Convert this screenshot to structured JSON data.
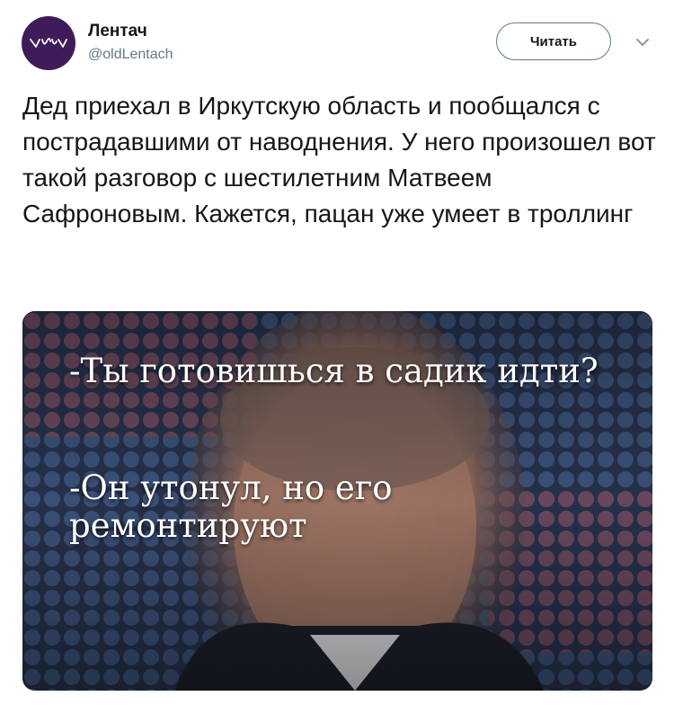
{
  "account": {
    "name": "Лентач",
    "handle": "@oldLentach",
    "avatar_color": "#3f1c59"
  },
  "actions": {
    "follow_label": "Читать",
    "menu_icon": "chevron-down-icon"
  },
  "tweet": {
    "text": "Дед приехал в Иркутскую область и пообщался с пострадавшими от наводнения. У него произошел вот такой разговор с шестилетним Матвеем Сафроновым. Кажется, пацан уже умеет в троллинг"
  },
  "media": {
    "caption_line1": "-Ты готовишься в садик идти?",
    "caption_line2": "-Он утонул, но его ремонтируют"
  }
}
